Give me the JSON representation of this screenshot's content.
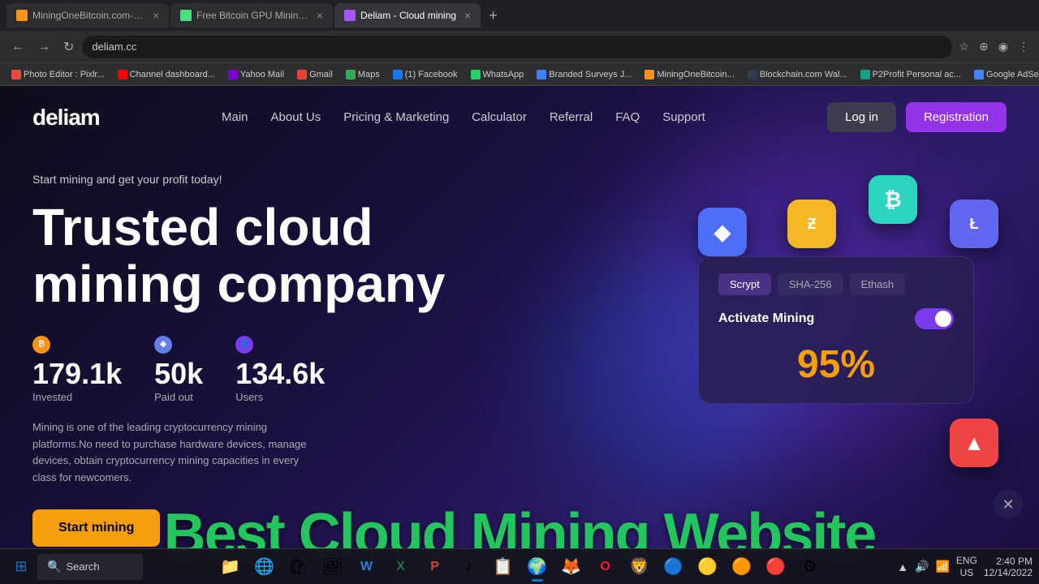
{
  "browser": {
    "tabs": [
      {
        "id": 1,
        "title": "MiningOneBitcoin.com-Mining...",
        "favicon_color": "#f7931a",
        "active": false
      },
      {
        "id": 2,
        "title": "Free Bitcoin GPU Mining, Cloud...",
        "favicon_color": "#4ade80",
        "active": false
      },
      {
        "id": 3,
        "title": "Deliam - Cloud mining",
        "favicon_color": "#a855f7",
        "active": true
      }
    ],
    "address": "deliam.cc",
    "bookmarks": [
      {
        "label": "Photo Editor : Pixlr...",
        "color": "#e74c3c"
      },
      {
        "label": "Channel dashboard...",
        "color": "#ff0000"
      },
      {
        "label": "Yahoo Mail",
        "color": "#7b00d4"
      },
      {
        "label": "Gmail",
        "color": "#ea4335"
      },
      {
        "label": "Maps",
        "color": "#34a853"
      },
      {
        "label": "(1) Facebook",
        "color": "#1877f2"
      },
      {
        "label": "WhatsApp",
        "color": "#25d366"
      },
      {
        "label": "Branded Surveys J...",
        "color": "#3b82f6"
      },
      {
        "label": "MiningOneBitcoin...",
        "color": "#f7931a"
      },
      {
        "label": "Blockchain.com Wal...",
        "color": "#2c3e50"
      },
      {
        "label": "P2Profit Personal ac...",
        "color": "#16a085"
      },
      {
        "label": "Google AdSense",
        "color": "#4285f4"
      }
    ]
  },
  "site": {
    "logo": "deliam",
    "nav_links": [
      {
        "label": "Main"
      },
      {
        "label": "About Us"
      },
      {
        "label": "Pricing & Marketing"
      },
      {
        "label": "Calculator"
      },
      {
        "label": "Referral"
      },
      {
        "label": "FAQ"
      },
      {
        "label": "Support"
      }
    ],
    "login_label": "Log in",
    "register_label": "Registration",
    "hero_subtitle": "Start mining and get your profit today!",
    "hero_title_line1": "Trusted cloud",
    "hero_title_line2": "mining company",
    "stats": [
      {
        "icon_type": "btc",
        "icon_label": "₿",
        "value": "179.1k",
        "label": "Invested"
      },
      {
        "icon_type": "eth",
        "icon_label": "◈",
        "value": "50k",
        "label": "Paid out"
      },
      {
        "icon_type": "user",
        "icon_label": "👤",
        "value": "134.6k",
        "label": "Users"
      }
    ],
    "hero_desc": "Mining is one of the leading cryptocurrency mining platforms.No need to purchase hardware devices, manage devices, obtain cryptocurrency mining capacities in every class for newcomers.",
    "start_btn": "Start mining",
    "mining_widget": {
      "tabs": [
        "Scrypt",
        "SHA-256",
        "Ethash"
      ],
      "active_tab": "Scrypt",
      "activate_label": "Activate Mining",
      "percent": "95%"
    },
    "overlay_text": "Best Cloud Mining Website"
  },
  "taskbar": {
    "search_label": "Search",
    "time": "2:40 PM",
    "date": "12/14/2022",
    "lang": "ENG\nUS",
    "apps": [
      {
        "name": "file-explorer",
        "icon": "📁"
      },
      {
        "name": "edge",
        "icon": "🌐"
      },
      {
        "name": "store",
        "icon": "🛍"
      },
      {
        "name": "photos",
        "icon": "🖼"
      },
      {
        "name": "word",
        "icon": "W"
      },
      {
        "name": "excel",
        "icon": "X"
      },
      {
        "name": "powerpoint",
        "icon": "P"
      },
      {
        "name": "music",
        "icon": "♪"
      },
      {
        "name": "task1",
        "icon": "📋"
      },
      {
        "name": "chrome",
        "icon": "🌍"
      },
      {
        "name": "firefox",
        "icon": "🦊"
      },
      {
        "name": "opera",
        "icon": "O"
      },
      {
        "name": "brave",
        "icon": "🦁"
      },
      {
        "name": "app2",
        "icon": "🔵"
      },
      {
        "name": "app3",
        "icon": "🟡"
      },
      {
        "name": "app4",
        "icon": "🟠"
      },
      {
        "name": "app5",
        "icon": "🔴"
      },
      {
        "name": "app6",
        "icon": "⚙"
      }
    ]
  }
}
